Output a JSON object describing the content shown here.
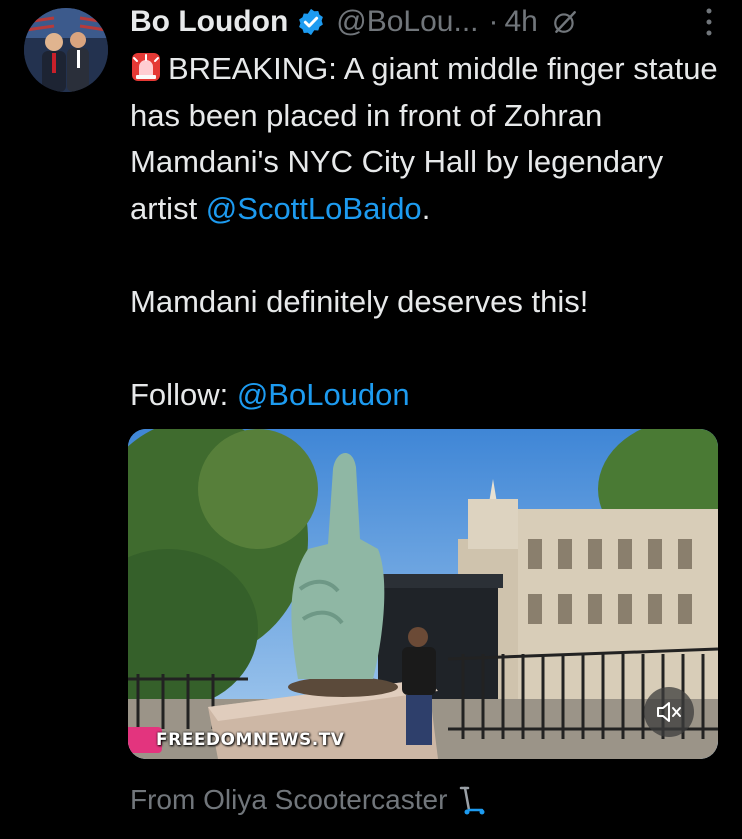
{
  "author": {
    "name": "Bo Loudon",
    "handle": "@BoLou...",
    "separator": "·",
    "time": "4h",
    "verified": true
  },
  "tweet": {
    "line1_rest": "BREAKING: A giant middle finger statue has been placed in front of Zohran Mamdani's NYC City Hall by legendary artist ",
    "mention1": "@ScottLoBaido",
    "line1_end": ".",
    "para2": "Mamdani definitely deserves this!",
    "follow_label": "Follow: ",
    "mention2": "@BoLoudon",
    "leading_emoji": "siren-icon"
  },
  "media": {
    "type": "video",
    "watermark": "FREEDOMNEWS.TV",
    "muted": true
  },
  "footer": {
    "from_text": "From Oliya Scootercaster",
    "trailing_emoji": "scooter-icon"
  },
  "colors": {
    "background": "#000000",
    "text": "#e7e9ea",
    "secondary": "#71767b",
    "link": "#1d9bf0",
    "verified": "#1d9bf0"
  }
}
